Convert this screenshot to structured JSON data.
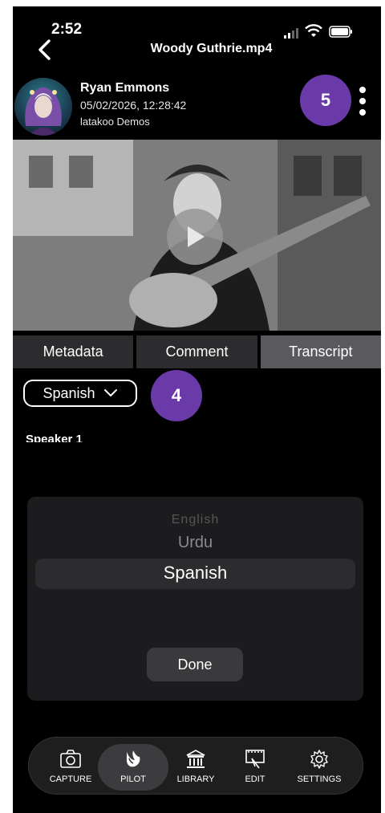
{
  "status_bar": {
    "time": "2:52"
  },
  "nav": {
    "title": "Woody Guthrie.mp4"
  },
  "header": {
    "user_name": "Ryan Emmons",
    "timestamp": "05/02/2026, 12:28:42",
    "org": "latakoo Demos",
    "badge_5": "5"
  },
  "tabs": [
    {
      "label": "Metadata",
      "active": false
    },
    {
      "label": "Comment",
      "active": false
    },
    {
      "label": "Transcript",
      "active": true
    }
  ],
  "transcript": {
    "language_selected": "Spanish",
    "badge_4": "4",
    "speaker_label": "Speaker 1"
  },
  "picker": {
    "options": [
      "English",
      "Urdu",
      "Spanish"
    ],
    "selected": "Spanish",
    "done_label": "Done"
  },
  "bottom_nav": [
    {
      "label": "CAPTURE",
      "icon": "camera-icon"
    },
    {
      "label": "PILOT",
      "icon": "bird-icon",
      "active": true
    },
    {
      "label": "LIBRARY",
      "icon": "library-icon"
    },
    {
      "label": "EDIT",
      "icon": "film-edit-icon"
    },
    {
      "label": "SETTINGS",
      "icon": "gear-icon"
    }
  ],
  "colors": {
    "accent_purple": "#6a3aa8",
    "background": "#000000",
    "tab_active": "#5a5a5e",
    "tab_inactive": "#2c2c2e"
  }
}
